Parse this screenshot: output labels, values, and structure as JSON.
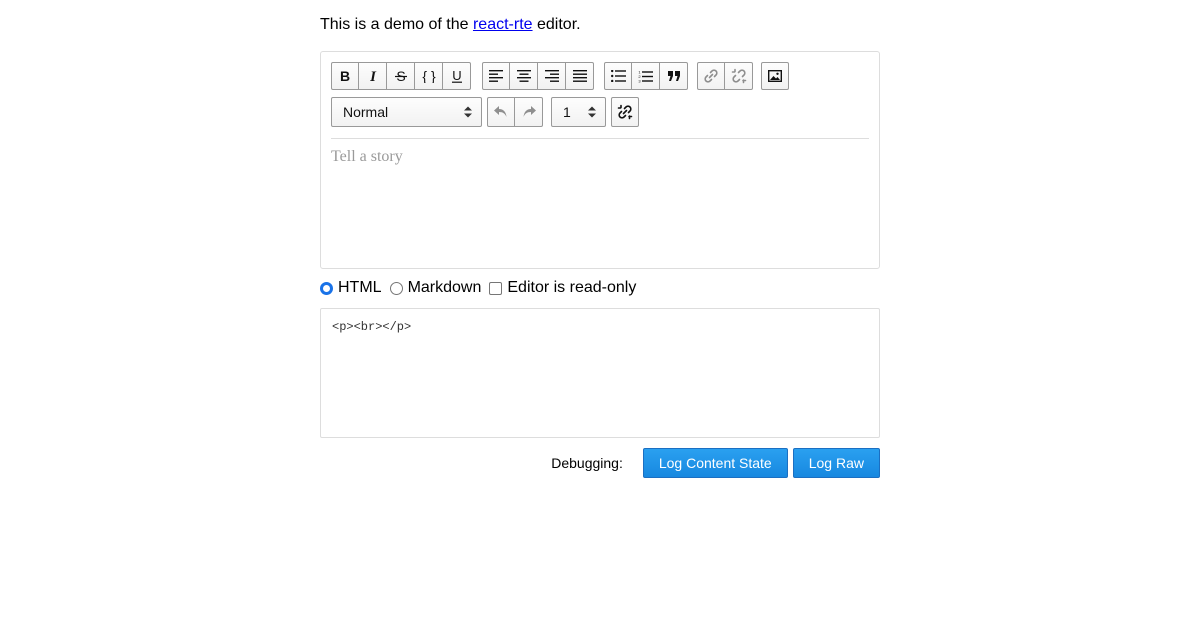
{
  "intro": {
    "prefix": "This is a demo of the ",
    "link_text": "react-rte",
    "suffix": " editor."
  },
  "toolbar": {
    "inline_styles": [
      {
        "name": "bold-button",
        "icon": "bold-icon",
        "label": "B"
      },
      {
        "name": "italic-button",
        "icon": "italic-icon",
        "label": "I"
      },
      {
        "name": "strikethrough-button",
        "icon": "strikethrough-icon",
        "label": "S"
      },
      {
        "name": "code-button",
        "icon": "code-icon",
        "label": "{ }"
      },
      {
        "name": "underline-button",
        "icon": "underline-icon",
        "label": "U"
      }
    ],
    "alignment": [
      "align-left-icon",
      "align-center-icon",
      "align-right-icon",
      "align-justify-icon"
    ],
    "blocks": [
      "unordered-list-icon",
      "ordered-list-icon",
      "blockquote-icon"
    ],
    "links": [
      "link-icon",
      "unlink-icon"
    ],
    "image": "image-icon",
    "block_type_selected": "Normal",
    "history": [
      "undo-icon",
      "redo-icon"
    ],
    "number_selected": "1",
    "extra": "remove-link-icon"
  },
  "editor": {
    "placeholder": "Tell a story"
  },
  "format": {
    "html_label": "HTML",
    "markdown_label": "Markdown",
    "readonly_label": "Editor is read-only",
    "selected": "HTML"
  },
  "source": {
    "value": "<p><br></p>"
  },
  "debug": {
    "label": "Debugging:",
    "log_content_state": "Log Content State",
    "log_raw": "Log Raw"
  },
  "colors": {
    "primary": "#1788e0",
    "link": "#0000ee",
    "placeholder": "#9a9a9a",
    "border": "#dddddd"
  }
}
